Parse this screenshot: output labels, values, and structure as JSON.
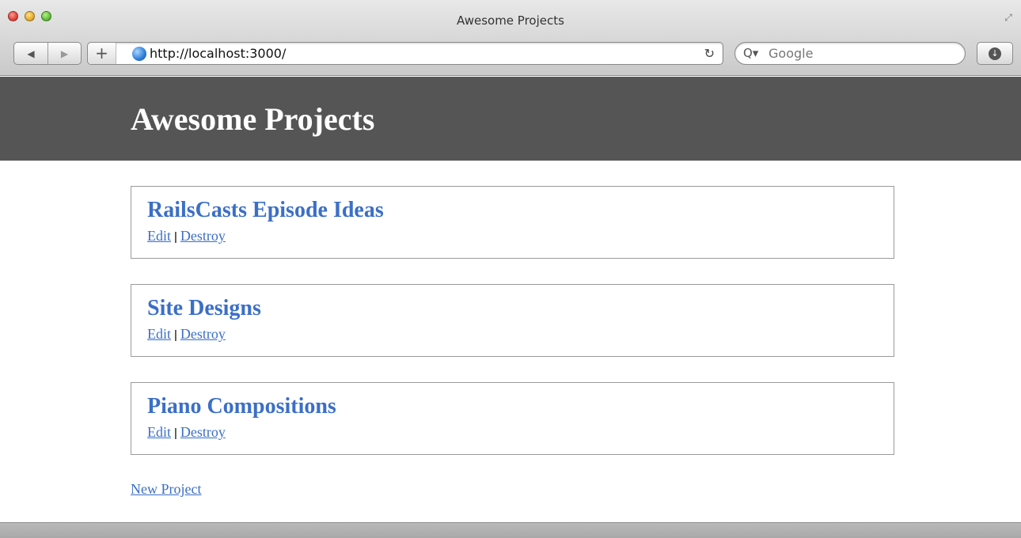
{
  "window": {
    "title": "Awesome Projects"
  },
  "toolbar": {
    "back_icon": "◀",
    "forward_icon": "▶",
    "add_icon": "+",
    "url": "http://localhost:3000/",
    "reload_icon": "↻",
    "search_icon": "Q▾",
    "search_placeholder": "Google",
    "download_icon": "↓"
  },
  "page": {
    "title": "Awesome Projects",
    "projects": [
      {
        "name": "RailsCasts Episode Ideas",
        "edit_label": "Edit",
        "separator": "|",
        "destroy_label": "Destroy"
      },
      {
        "name": "Site Designs",
        "edit_label": "Edit",
        "separator": "|",
        "destroy_label": "Destroy"
      },
      {
        "name": "Piano Compositions",
        "edit_label": "Edit",
        "separator": "|",
        "destroy_label": "Destroy"
      }
    ],
    "new_project_label": "New Project"
  },
  "colors": {
    "header_bg": "#555555",
    "link": "#3b6fc7",
    "card_border": "#9a9a9a"
  }
}
